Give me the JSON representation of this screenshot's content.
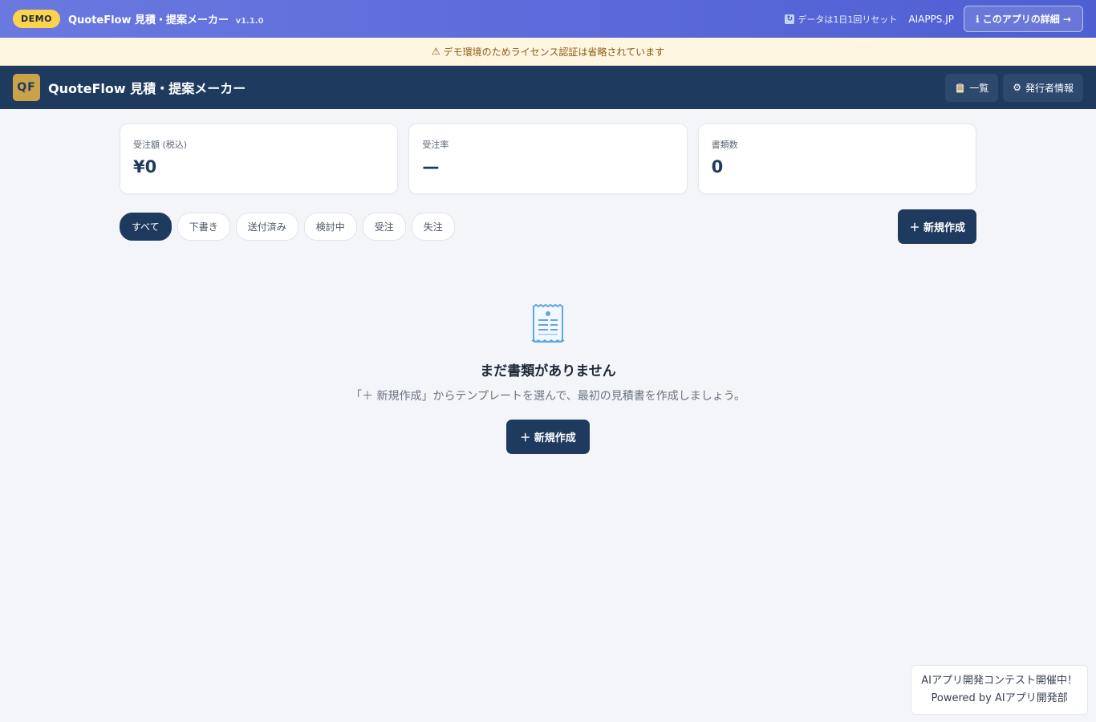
{
  "demo": {
    "badge": "DEMO",
    "title": "QuoteFlow 見積・提案メーカー",
    "version": "v1.1.0",
    "reset_note": "データは1日1回リセット",
    "aiapps": "AIAPPS.JP",
    "detail_button": "ℹ このアプリの詳細 →"
  },
  "warning": {
    "icon": "⚠",
    "text": "デモ環境のためライセンス認証は省略されています"
  },
  "header": {
    "logo": "QF",
    "title": "QuoteFlow 見積・提案メーカー",
    "list_button": "一覧",
    "issuer_button": "発行者情報"
  },
  "stats": [
    {
      "label": "受注額 (税込)",
      "value": "¥0"
    },
    {
      "label": "受注率",
      "value": "—"
    },
    {
      "label": "書類数",
      "value": "0"
    }
  ],
  "filters": [
    {
      "label": "すべて",
      "active": true
    },
    {
      "label": "下書き",
      "active": false
    },
    {
      "label": "送付済み",
      "active": false
    },
    {
      "label": "検討中",
      "active": false
    },
    {
      "label": "受注",
      "active": false
    },
    {
      "label": "失注",
      "active": false
    }
  ],
  "new_button": "＋ 新規作成",
  "empty": {
    "title": "まだ書類がありません",
    "description": "「＋ 新規作成」からテンプレートを選んで、最初の見積書を作成しましょう。",
    "button": "＋ 新規作成"
  },
  "footer": {
    "line1": "AIアプリ開発コンテスト開催中！",
    "line2": "Powered by AIアプリ開発部"
  },
  "colors": {
    "primary": "#1e3a5f",
    "demo_badge": "#fcd34d",
    "logo_bg": "#c9a24a",
    "warning_bg": "#fef6e0"
  }
}
